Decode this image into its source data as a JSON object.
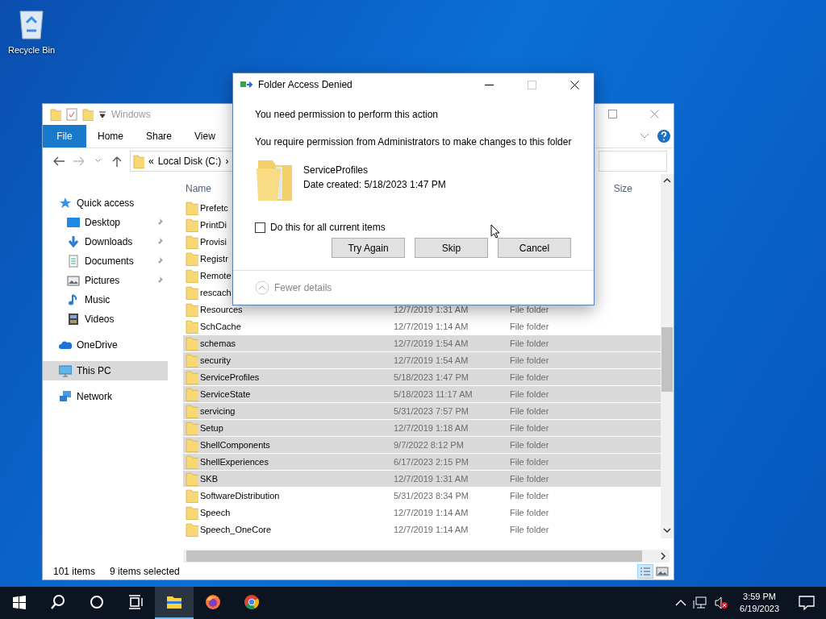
{
  "desktop": {
    "icons": [
      {
        "label": "Recycle Bin"
      }
    ]
  },
  "explorer": {
    "title": "Windows",
    "file_tab": "File",
    "ribbon_tabs": [
      "Home",
      "Share",
      "View"
    ],
    "address": {
      "overflow": "«",
      "crumb": "Local Disk (C:)",
      "separator": "›"
    },
    "nav": [
      {
        "label": "Quick access",
        "kind": "star",
        "selected": false,
        "children": [
          {
            "label": "Desktop",
            "kind": "desktop",
            "pinned": true,
            "selected": false
          },
          {
            "label": "Downloads",
            "kind": "download",
            "pinned": true,
            "selected": false
          },
          {
            "label": "Documents",
            "kind": "document",
            "pinned": true,
            "selected": false
          },
          {
            "label": "Pictures",
            "kind": "pictures",
            "pinned": true,
            "selected": false
          },
          {
            "label": "Music",
            "kind": "music",
            "pinned": false,
            "selected": false
          },
          {
            "label": "Videos",
            "kind": "video",
            "pinned": false,
            "selected": false
          }
        ]
      },
      {
        "label": "OneDrive",
        "kind": "cloud",
        "selected": false
      },
      {
        "label": "This PC",
        "kind": "pc",
        "selected": true
      },
      {
        "label": "Network",
        "kind": "network",
        "selected": false
      }
    ],
    "columns": [
      {
        "label": "Name",
        "kind": "name"
      },
      {
        "label": "Size",
        "kind": "size"
      }
    ],
    "rows": [
      {
        "name": "Prefetc",
        "selected": false
      },
      {
        "name": "PrintDi",
        "selected": false
      },
      {
        "name": "Provisi",
        "selected": false
      },
      {
        "name": "Registr",
        "selected": false
      },
      {
        "name": "Remote",
        "selected": false
      },
      {
        "name": "rescach",
        "selected": false
      },
      {
        "name": "Resources",
        "date": "12/7/2019 1:31 AM",
        "type": "File folder",
        "selected": false
      },
      {
        "name": "SchCache",
        "date": "12/7/2019 1:14 AM",
        "type": "File folder",
        "selected": false
      },
      {
        "name": "schemas",
        "date": "12/7/2019 1:54 AM",
        "type": "File folder",
        "selected": true
      },
      {
        "name": "security",
        "date": "12/7/2019 1:54 AM",
        "type": "File folder",
        "selected": true
      },
      {
        "name": "ServiceProfiles",
        "date": "5/18/2023 1:47 PM",
        "type": "File folder",
        "selected": true
      },
      {
        "name": "ServiceState",
        "date": "5/18/2023 11:17 AM",
        "type": "File folder",
        "selected": true
      },
      {
        "name": "servicing",
        "date": "5/31/2023 7:57 PM",
        "type": "File folder",
        "selected": true
      },
      {
        "name": "Setup",
        "date": "12/7/2019 1:18 AM",
        "type": "File folder",
        "selected": true
      },
      {
        "name": "ShellComponents",
        "date": "9/7/2022 8:12 PM",
        "type": "File folder",
        "selected": true
      },
      {
        "name": "ShellExperiences",
        "date": "6/17/2023 2:15 PM",
        "type": "File folder",
        "selected": true
      },
      {
        "name": "SKB",
        "date": "12/7/2019 1:31 AM",
        "type": "File folder",
        "selected": true
      },
      {
        "name": "SoftwareDistribution",
        "date": "5/31/2023 8:34 PM",
        "type": "File folder",
        "selected": false
      },
      {
        "name": "Speech",
        "date": "12/7/2019 1:14 AM",
        "type": "File folder",
        "selected": false
      },
      {
        "name": "Speech_OneCore",
        "date": "12/7/2019 1:14 AM",
        "type": "File folder",
        "selected": false
      }
    ],
    "status": {
      "count": "101 items",
      "selection": "9 items selected"
    }
  },
  "dialog": {
    "title": "Folder Access Denied",
    "maximize_enabled": false,
    "heading": "You need permission to perform this action",
    "message": "You require permission from Administrators to make changes to this folder",
    "item": {
      "name": "ServiceProfiles",
      "date": "Date created: 5/18/2023 1:47 PM"
    },
    "checkbox": {
      "label": "Do this for all current items",
      "checked": false
    },
    "buttons": [
      "Try Again",
      "Skip",
      "Cancel"
    ],
    "details_toggle": "Fewer details"
  },
  "taskbar": {
    "apps": [
      {
        "kind": "start",
        "active": false
      },
      {
        "kind": "search",
        "active": false
      },
      {
        "kind": "cortana",
        "active": false
      },
      {
        "kind": "taskview",
        "active": false
      },
      {
        "kind": "explorer",
        "active": true
      },
      {
        "kind": "firefox",
        "active": false
      },
      {
        "kind": "chrome",
        "active": false
      }
    ],
    "time": "3:59 PM",
    "date": "6/19/2023"
  }
}
